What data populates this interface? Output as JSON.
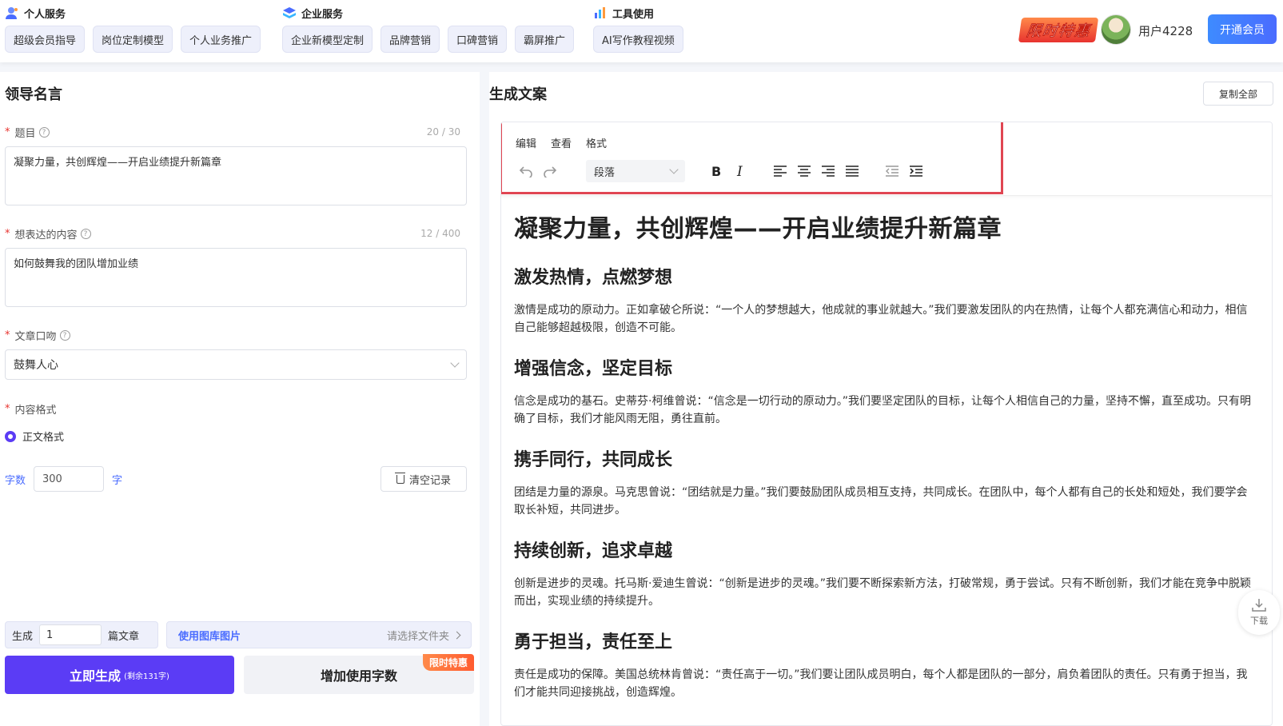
{
  "nav": {
    "groups": [
      {
        "title": "个人服务",
        "items": [
          "超级会员指导",
          "岗位定制模型",
          "个人业务推广"
        ]
      },
      {
        "title": "企业服务",
        "items": [
          "企业新模型定制",
          "品牌营销",
          "口碑营销",
          "霸屏推广"
        ]
      },
      {
        "title": "工具使用",
        "items": [
          "AI写作教程视频"
        ]
      }
    ],
    "promo": "限时特惠",
    "username": "用户4228",
    "vip_label": "开通会员"
  },
  "form": {
    "title": "领导名言",
    "topic": {
      "label": "题目",
      "counter": "20 / 30",
      "value": "凝聚力量，共创辉煌——开启业绩提升新篇章"
    },
    "content": {
      "label": "想表达的内容",
      "counter": "12 / 400",
      "value": "如何鼓舞我的团队增加业绩"
    },
    "tone": {
      "label": "文章口吻",
      "value": "鼓舞人心"
    },
    "format": {
      "label": "内容格式",
      "option": "正文格式"
    },
    "wordcount": {
      "label": "字数",
      "value": "300",
      "unit": "字"
    },
    "clear_label": "清空记录",
    "generate": {
      "prefix": "生成",
      "count": "1",
      "suffix": "篇文章"
    },
    "library": {
      "title": "使用图库图片",
      "hint": "请选择文件夹"
    },
    "submit": {
      "label": "立即生成",
      "remaining": "(剩余131字)"
    },
    "more": {
      "label": "增加使用字数",
      "tag": "限时特惠"
    }
  },
  "output": {
    "title": "生成文案",
    "copy_all": "复制全部",
    "menus": [
      "编辑",
      "查看",
      "格式"
    ],
    "block_format": "段落",
    "download_label": "下载",
    "doc": {
      "title": "凝聚力量，共创辉煌——开启业绩提升新篇章",
      "sections": [
        {
          "heading": "激发热情，点燃梦想",
          "body": "激情是成功的原动力。正如拿破仑所说：“一个人的梦想越大，他成就的事业就越大。”我们要激发团队的内在热情，让每个人都充满信心和动力，相信自己能够超越极限，创造不可能。"
        },
        {
          "heading": "增强信念，坚定目标",
          "body": "信念是成功的基石。史蒂芬·柯维曾说：“信念是一切行动的原动力。”我们要坚定团队的目标，让每个人相信自己的力量，坚持不懈，直至成功。只有明确了目标，我们才能风雨无阻，勇往直前。"
        },
        {
          "heading": "携手同行，共同成长",
          "body": "团结是力量的源泉。马克思曾说：“团结就是力量。”我们要鼓励团队成员相互支持，共同成长。在团队中，每个人都有自己的长处和短处，我们要学会取长补短，共同进步。"
        },
        {
          "heading": "持续创新，追求卓越",
          "body": "创新是进步的灵魂。托马斯·爱迪生曾说：“创新是进步的灵魂。”我们要不断探索新方法，打破常规，勇于尝试。只有不断创新，我们才能在竞争中脱颖而出，实现业绩的持续提升。"
        },
        {
          "heading": "勇于担当，责任至上",
          "body": "责任是成功的保障。美国总统林肯曾说：“责任高于一切。”我们要让团队成员明白，每个人都是团队的一部分，肩负着团队的责任。只有勇于担当，我们才能共同迎接挑战，创造辉煌。"
        }
      ]
    }
  }
}
